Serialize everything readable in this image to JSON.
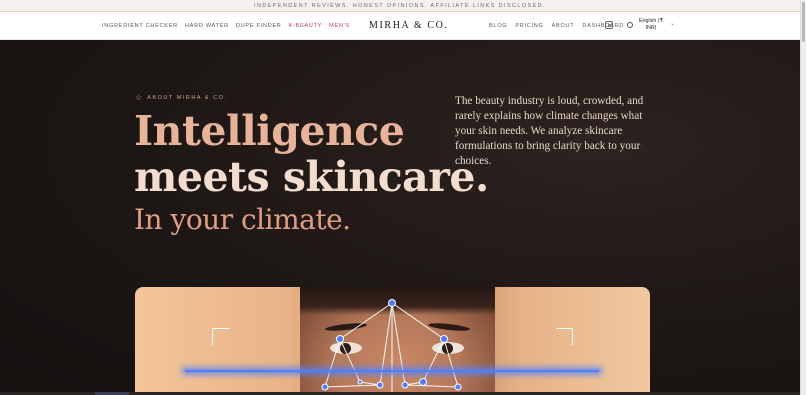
{
  "announcement": "Independent reviews. Honest opinions. Affiliate links disclosed.",
  "nav": {
    "left": [
      "Ingredient Checker",
      "Hard Water",
      "Dupe Finder",
      "K-Beauty",
      "Men's"
    ],
    "brand": "MIRHA & CO.",
    "right": [
      "Blog",
      "Pricing",
      "About",
      "Dashboard"
    ],
    "language": "English (₹ INR)",
    "icons": {
      "social": "instagram-icon",
      "language": "globe-icon",
      "dropdown": "chevron-down-icon"
    }
  },
  "hero": {
    "eyebrow": "About Mirha & Co.",
    "eyebrow_icon": "star-icon",
    "headline_1": "Intelligence",
    "headline_2": "meets skincare.",
    "headline_3": "In your climate.",
    "description": "The beauty industry is loud, crowded, and rarely explains how climate changes what your skin needs. We analyze skincare formulations to bring clarity back to your choices."
  },
  "colors": {
    "accent_pink": "#c03574",
    "headline_peach": "#e9b399",
    "scan_blue": "#4f7dff",
    "background": "#1b1513"
  }
}
